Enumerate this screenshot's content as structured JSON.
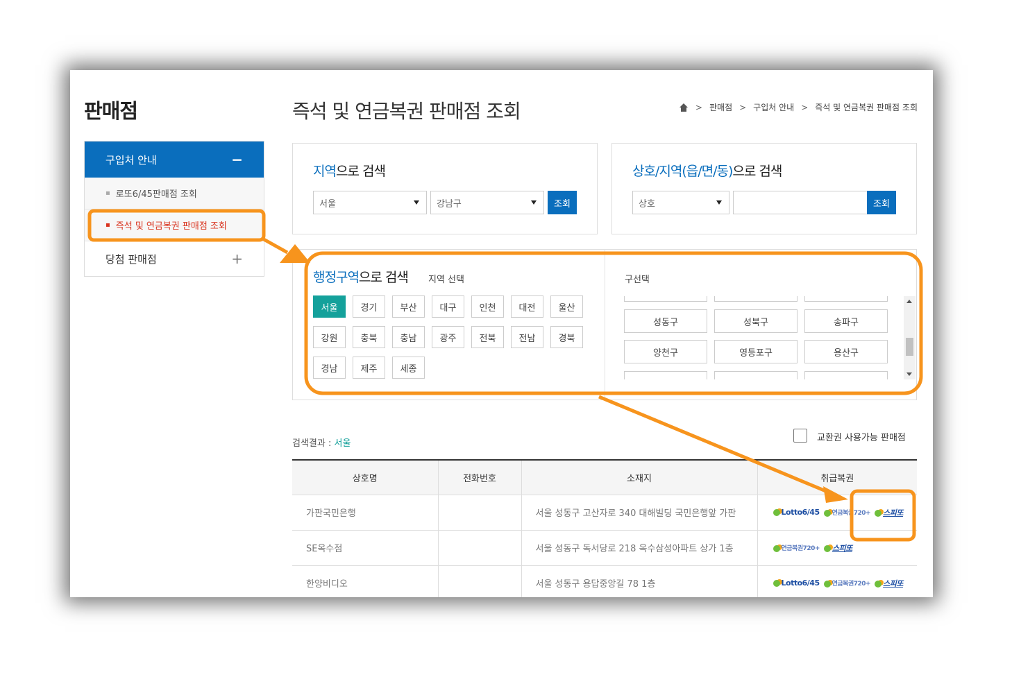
{
  "sidebar": {
    "title": "판매점",
    "menu_head": {
      "label": "구입처 안내",
      "sign": "−"
    },
    "sub_items": [
      {
        "label": "로또6/45판매점 조회",
        "active": false
      },
      {
        "label": "즉석 및 연금복권 판매점 조회",
        "active": true
      }
    ],
    "menu_item": {
      "label": "당첨 판매점",
      "sign": "+"
    }
  },
  "header": {
    "title": "즉석 및 연금복권 판매점 조회",
    "breadcrumb": [
      "판매점",
      "구입처 안내",
      "즉석 및 연금복권 판매점 조회"
    ],
    "separator": ">"
  },
  "search_region": {
    "title_hl": "지역",
    "title_rest": "으로 검색",
    "select1": "서울",
    "select2": "강남구",
    "button": "조회"
  },
  "search_name": {
    "title_hl": "상호/지역(읍/면/동)",
    "title_rest": "으로 검색",
    "select": "상호",
    "input_value": "",
    "button": "조회"
  },
  "admin_region": {
    "title_hl": "행정구역",
    "title_rest": "으로 검색",
    "subtitle": "지역 선택",
    "regions": [
      "서울",
      "경기",
      "부산",
      "대구",
      "인천",
      "대전",
      "울산",
      "강원",
      "충북",
      "충남",
      "광주",
      "전북",
      "전남",
      "경북",
      "경남",
      "제주",
      "세종"
    ],
    "selected_region": "서울",
    "gu_title": "구선택",
    "gu_list": [
      "성동구",
      "성북구",
      "송파구",
      "양천구",
      "영등포구",
      "용산구"
    ]
  },
  "results": {
    "label": "검색결과 : ",
    "label_value": "서울",
    "checkbox_label": "교환권 사용가능 판매점",
    "columns": [
      "상호명",
      "전화번호",
      "소재지",
      "취급복권"
    ],
    "rows": [
      {
        "name": "가판국민은행",
        "phone": "",
        "address": "서울 성동구 고산자로 340 대해빌딩 국민은행앞 가판",
        "logos": [
          "Lotto6/45",
          "연금복권720+",
          "스피또"
        ]
      },
      {
        "name": "SE옥수점",
        "phone": "",
        "address": "서울 성동구 독서당로 218 옥수삼성아파트 상가 1층",
        "logos": [
          "연금복권720+",
          "스피또"
        ]
      },
      {
        "name": "한양비디오",
        "phone": "",
        "address": "서울 성동구 용답중앙길 78 1층",
        "logos": [
          "Lotto6/45",
          "연금복권720+",
          "스피또"
        ]
      }
    ]
  },
  "colors": {
    "primary_blue": "#0a6ebd",
    "active_teal": "#14a19b",
    "active_red": "#d9331f",
    "annotation_orange": "#f7941d"
  }
}
